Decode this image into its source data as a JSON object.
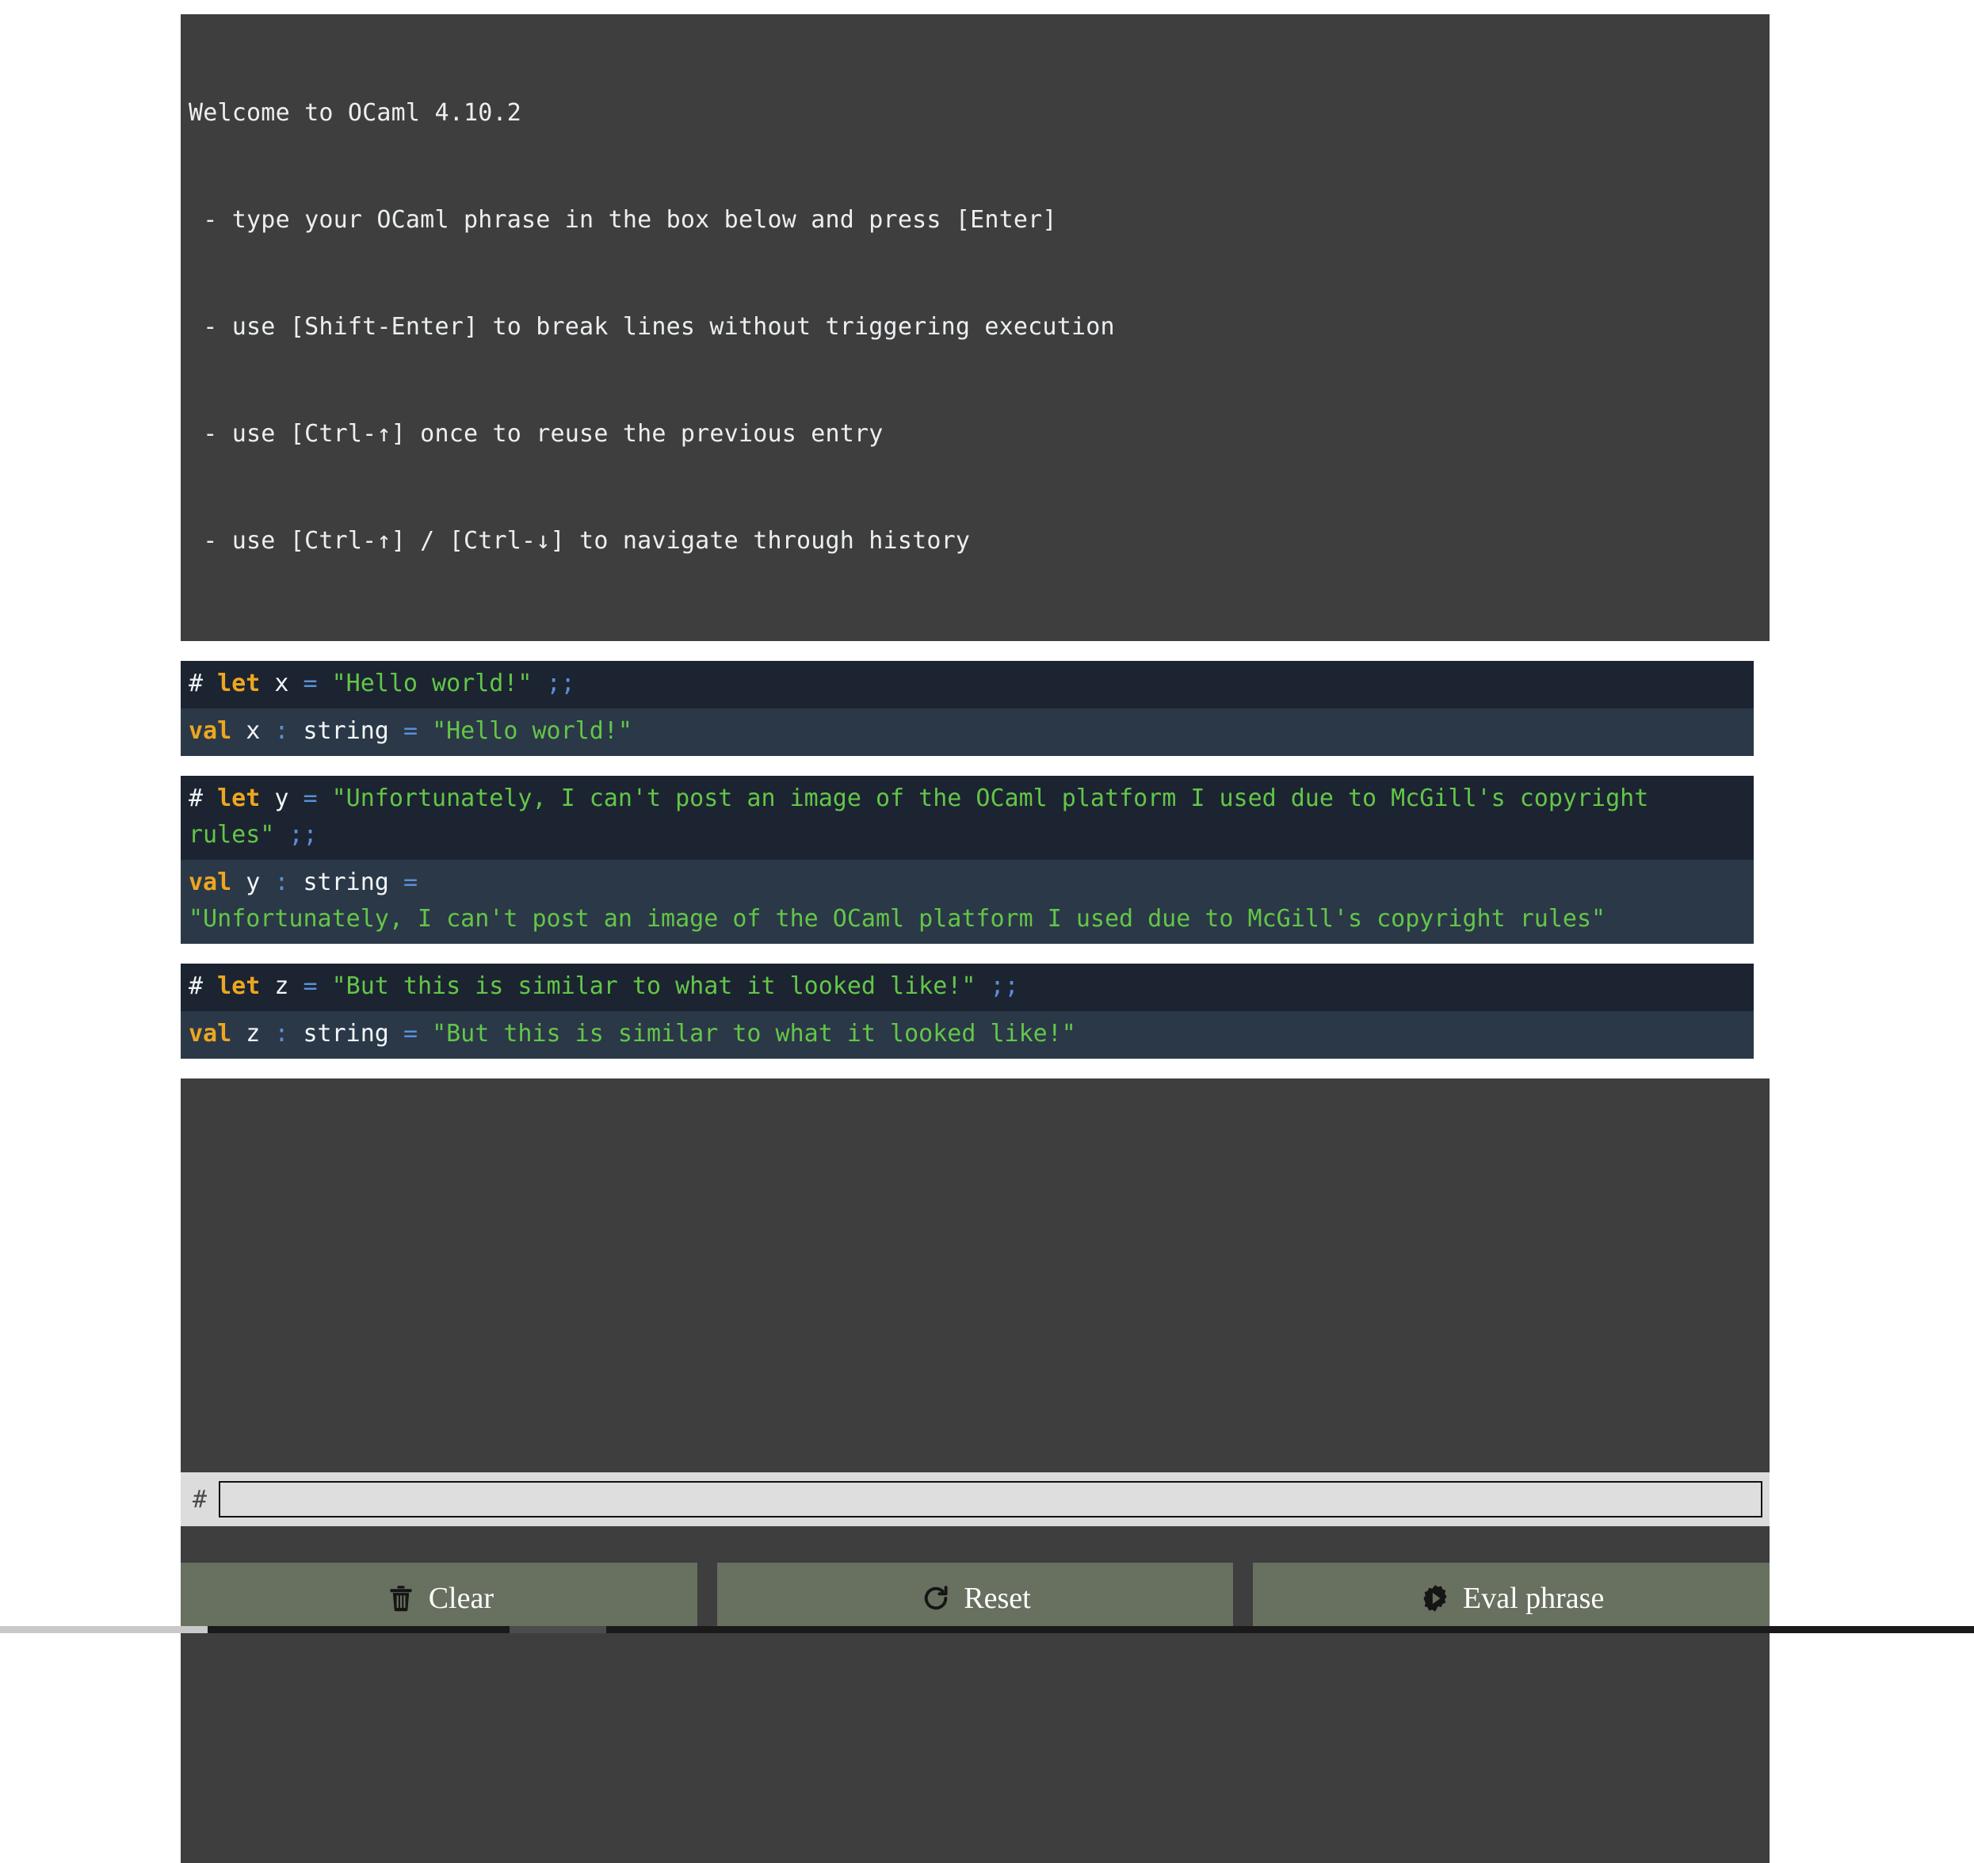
{
  "welcome": {
    "lines": [
      "Welcome to OCaml 4.10.2",
      " - type your OCaml phrase in the box below and press [Enter]",
      " - use [Shift-Enter] to break lines without triggering execution",
      " - use [Ctrl-↑] once to reuse the previous entry",
      " - use [Ctrl-↑] / [Ctrl-↓] to navigate through history"
    ]
  },
  "blocks": [
    {
      "input": {
        "prompt": "#",
        "keyword": "let",
        "ident": "x",
        "eq": "=",
        "value": "\"Hello world!\"",
        "terminator": ";;"
      },
      "output": {
        "keyword": "val",
        "ident": "x",
        "colon": ":",
        "type": "string",
        "eq": "=",
        "value": "\"Hello world!\""
      }
    },
    {
      "input": {
        "prompt": "#",
        "keyword": "let",
        "ident": "y",
        "eq": "=",
        "value": "\"Unfortunately, I can't post an image of the OCaml platform I used due to McGill's copyright rules\"",
        "terminator": ";;"
      },
      "output": {
        "keyword": "val",
        "ident": "y",
        "colon": ":",
        "type": "string",
        "eq": "=",
        "value": "\"Unfortunately, I can't post an image of the OCaml platform I used due to McGill's copyright rules\"",
        "value_wrapped": true
      }
    },
    {
      "input": {
        "prompt": "#",
        "keyword": "let",
        "ident": "z",
        "eq": "=",
        "value": "\"But this is similar to what it looked like!\"",
        "terminator": ";;"
      },
      "output": {
        "keyword": "val",
        "ident": "z",
        "colon": ":",
        "type": "string",
        "eq": "=",
        "value": "\"But this is similar to what it looked like!\""
      }
    }
  ],
  "input_row": {
    "prompt": "#",
    "value": "",
    "placeholder": ""
  },
  "buttons": [
    {
      "label": "Clear",
      "icon": "trash-icon"
    },
    {
      "label": "Reset",
      "icon": "refresh-icon"
    },
    {
      "label": "Eval phrase",
      "icon": "gear-play-icon"
    }
  ],
  "colors": {
    "welcome_bg": "#3e3e3e",
    "input_line_bg": "#1c2431",
    "output_line_bg": "#2b3847",
    "keyword": "#eda620",
    "string": "#63c648",
    "operator": "#5b8fd8",
    "identifier": "#f4f7fa",
    "button_bg": "#68705f",
    "input_field_bg": "#dedede"
  }
}
